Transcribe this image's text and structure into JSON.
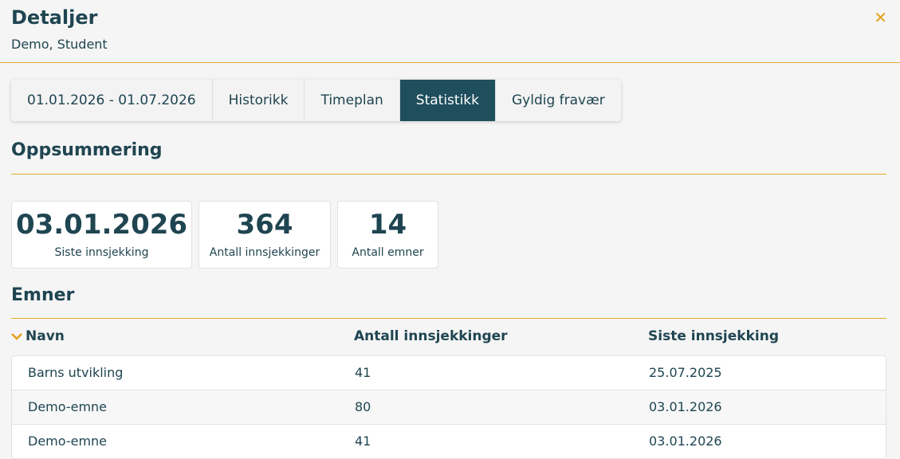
{
  "header": {
    "title": "Detaljer",
    "subtitle": "Demo, Student",
    "close_icon": "close-icon",
    "close_glyph": "✕"
  },
  "tabs": [
    {
      "label": "01.01.2026 - 01.07.2026",
      "active": false
    },
    {
      "label": "Historikk",
      "active": false
    },
    {
      "label": "Timeplan",
      "active": false
    },
    {
      "label": "Statistikk",
      "active": true
    },
    {
      "label": "Gyldig fravær",
      "active": false
    }
  ],
  "summary": {
    "title": "Oppsummering",
    "stats": [
      {
        "value": "03.01.2026",
        "label": "Siste innsjekking"
      },
      {
        "value": "364",
        "label": "Antall innsjekkinger"
      },
      {
        "value": "14",
        "label": "Antall emner"
      }
    ]
  },
  "subjects": {
    "title": "Emner",
    "sort_icon": "chevron-down-icon",
    "columns": [
      "Navn",
      "Antall innsjekkinger",
      "Siste innsjekking"
    ],
    "rows": [
      {
        "name": "Barns utvikling",
        "count": "41",
        "last": "25.07.2025"
      },
      {
        "name": "Demo-emne",
        "count": "80",
        "last": "03.01.2026"
      },
      {
        "name": "Demo-emne",
        "count": "41",
        "last": "03.01.2026"
      }
    ]
  },
  "colors": {
    "accent": "#e5ab2c",
    "primary": "#1f4e5c",
    "background": "#f5f5f5"
  }
}
